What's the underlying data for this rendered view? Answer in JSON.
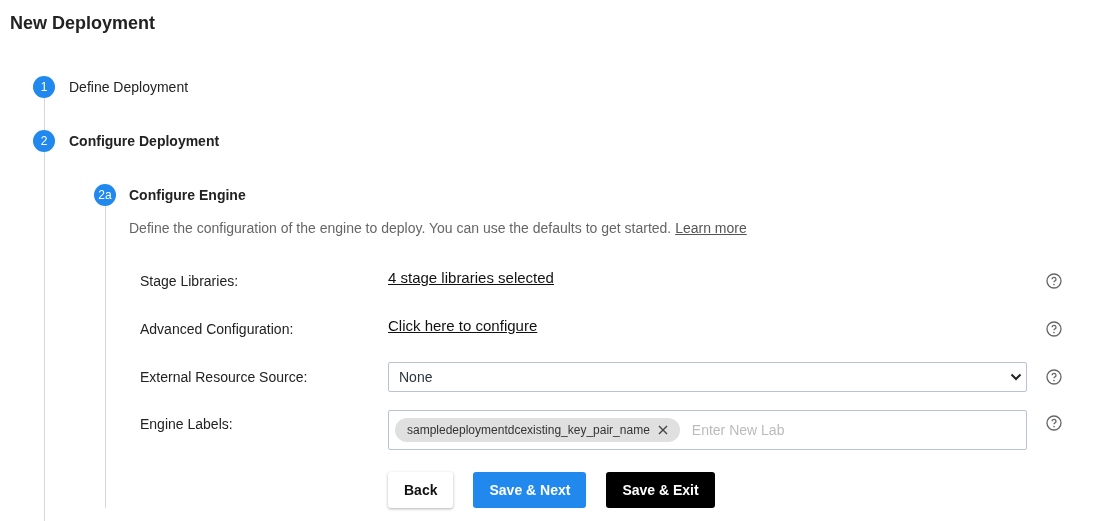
{
  "page_title": "New Deployment",
  "steps": [
    {
      "number": "1",
      "title": "Define Deployment",
      "selected": false
    },
    {
      "number": "2",
      "title": "Configure Deployment",
      "selected": true,
      "substep": {
        "number": "2a",
        "title": "Configure Engine",
        "description": "Define the configuration of the engine to deploy. You can use the defaults to get started.",
        "learn_more": "Learn more",
        "fields": [
          {
            "kind": "link",
            "label": "Stage Libraries:",
            "value": "4 stage libraries selected"
          },
          {
            "kind": "link",
            "label": "Advanced Configuration:",
            "value": "Click here to configure"
          },
          {
            "kind": "select",
            "label": "External Resource Source:",
            "value": "None"
          },
          {
            "kind": "tags",
            "label": "Engine Labels:",
            "tags": [
              "sampledeploymentdcexisting_key_pair_name"
            ],
            "placeholder": "Enter New Lab"
          }
        ],
        "buttons": [
          {
            "kind": "default",
            "label": "Back"
          },
          {
            "kind": "primary",
            "label": "Save & Next"
          },
          {
            "kind": "dark",
            "label": "Save & Exit"
          }
        ]
      }
    }
  ]
}
